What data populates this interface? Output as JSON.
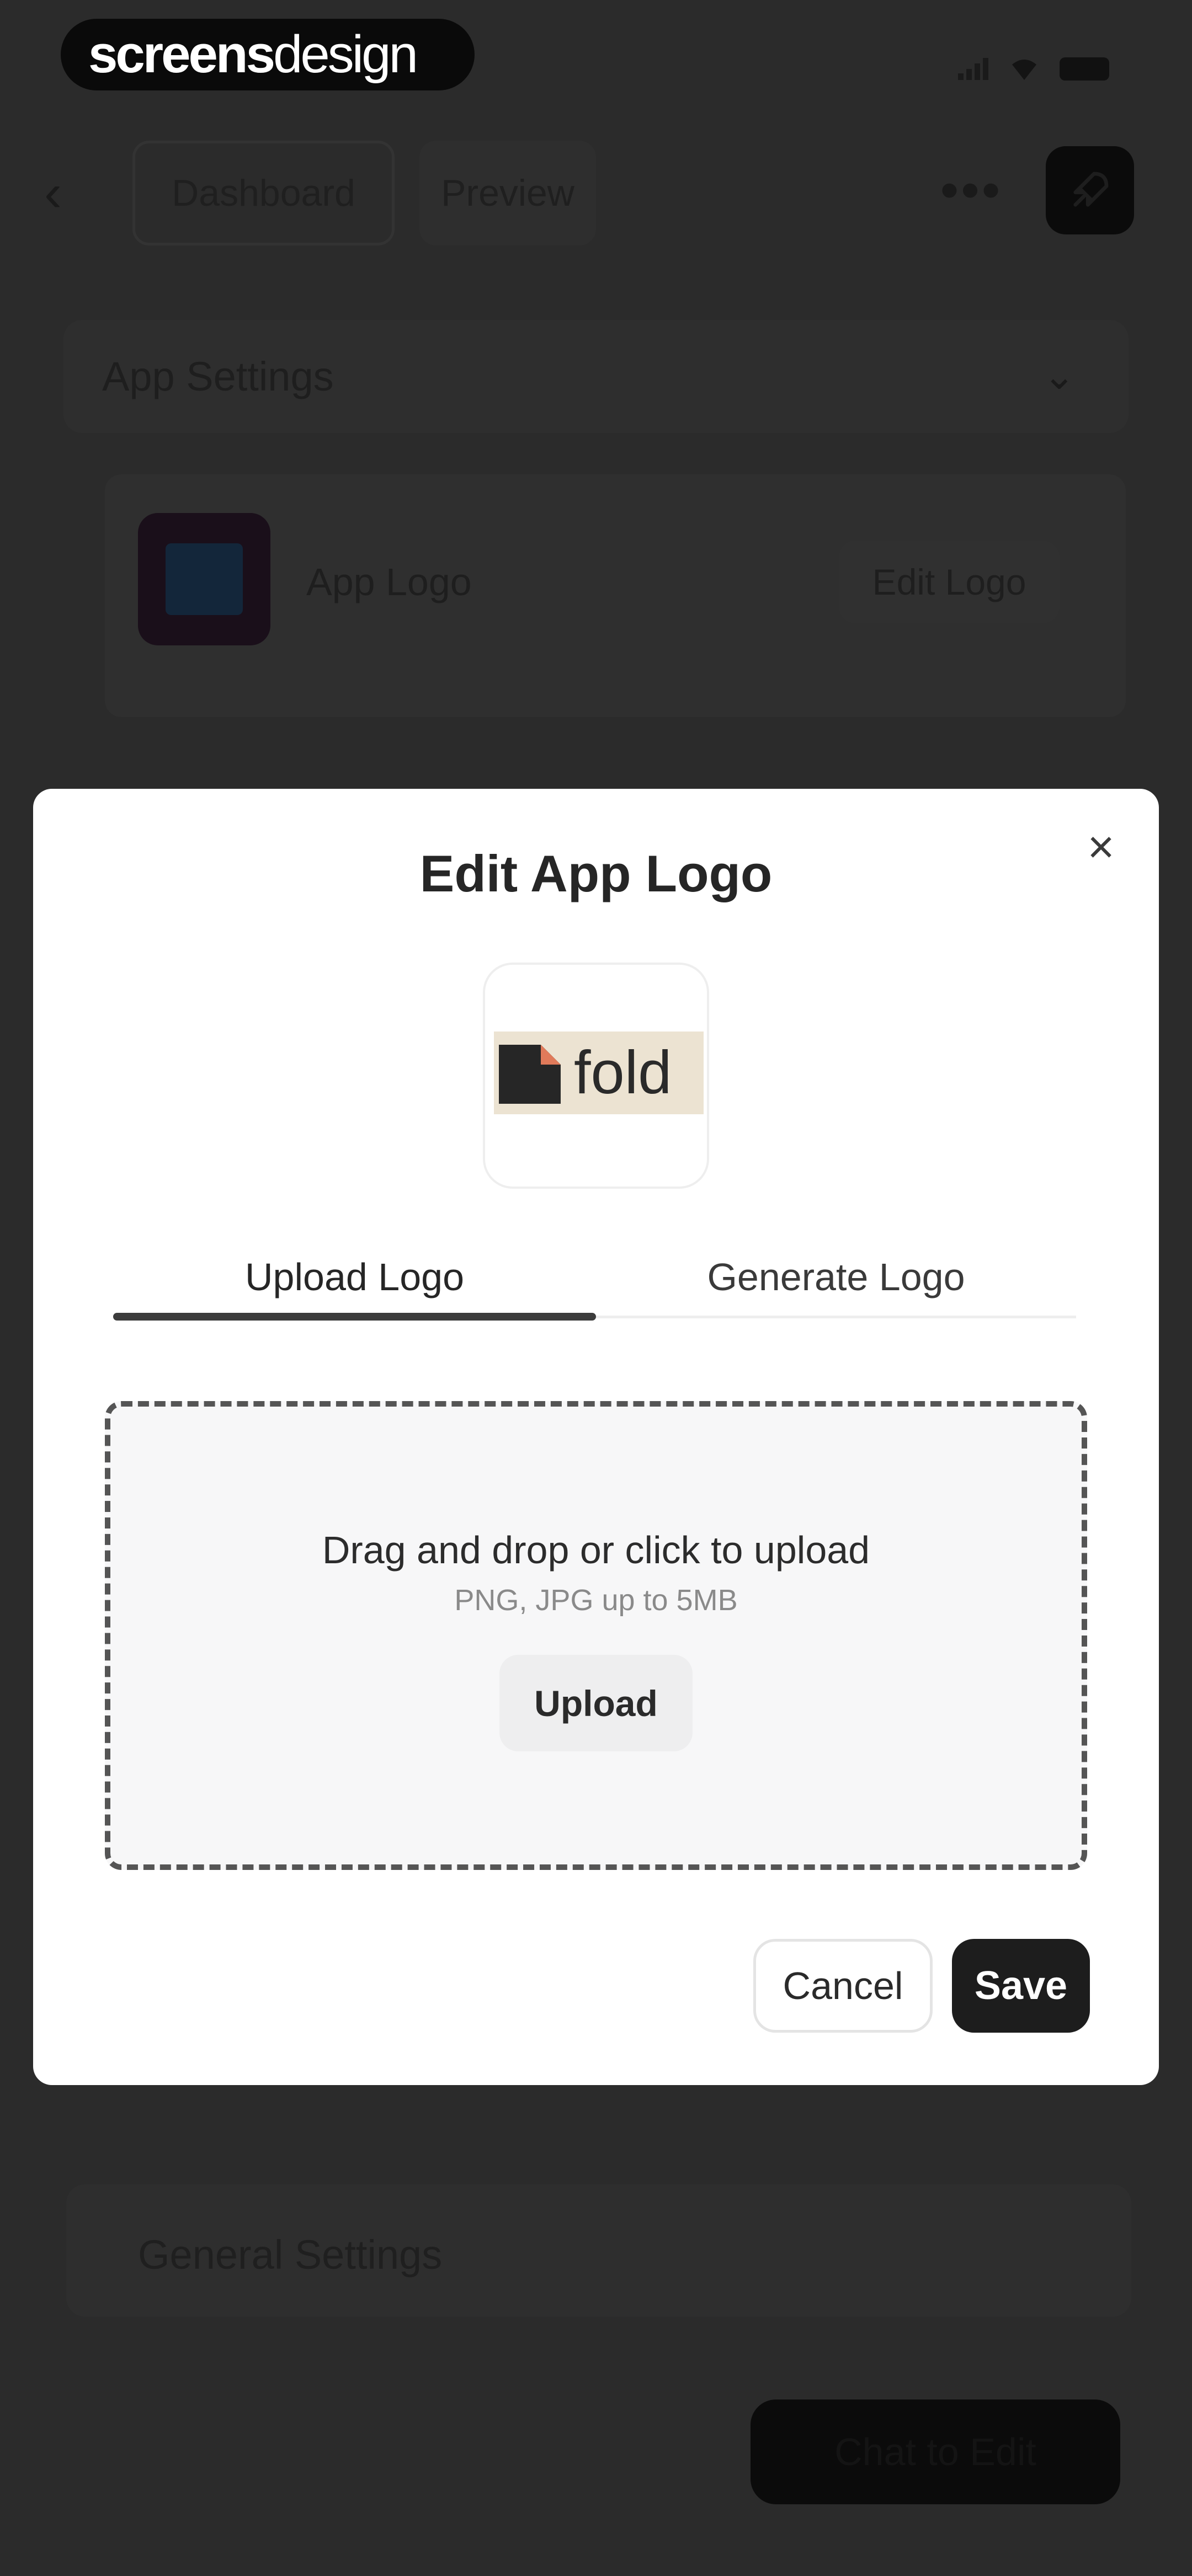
{
  "watermark": {
    "bold": "screens",
    "light": "design"
  },
  "header": {
    "tabs": [
      {
        "label": "Dashboard"
      },
      {
        "label": "Preview"
      }
    ],
    "more_label": "•••"
  },
  "app_settings": {
    "title": "App Settings",
    "logo_label": "App Logo",
    "edit_logo_label": "Edit Logo"
  },
  "general_settings": {
    "title": "General Settings"
  },
  "chat_button": {
    "label": "Chat to Edit"
  },
  "modal": {
    "title": "Edit App Logo",
    "close_label": "×",
    "logo_preview_text": "fold",
    "tabs": [
      {
        "label": "Upload Logo",
        "active": true
      },
      {
        "label": "Generate Logo",
        "active": false
      }
    ],
    "dropzone": {
      "instruction": "Drag and drop or click to upload",
      "hint": "PNG, JPG up to 5MB",
      "upload_label": "Upload"
    },
    "cancel_label": "Cancel",
    "save_label": "Save"
  },
  "colors": {
    "overlay_bg": "#2b2b2b",
    "modal_bg": "#ffffff",
    "primary_button": "#1d1d1d",
    "fold_accent": "#e07a5a",
    "fold_strip": "#ece3d2"
  },
  "icons": [
    "back-chevron-icon",
    "more-dots-icon",
    "rocket-icon",
    "chevron-down-icon",
    "close-icon",
    "signal-icon",
    "wifi-icon",
    "battery-icon"
  ]
}
